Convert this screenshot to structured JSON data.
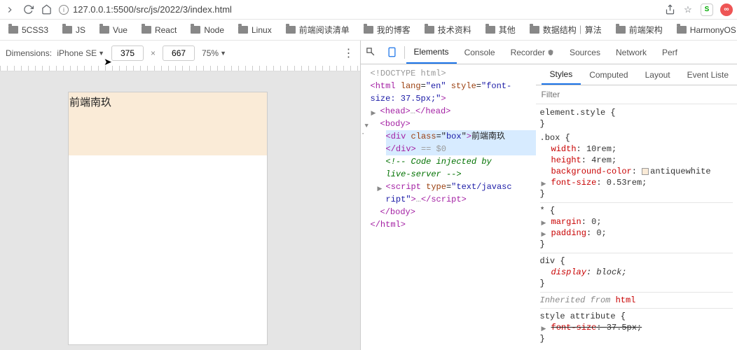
{
  "url": "127.0.0.1:5500/src/js/2022/3/index.html",
  "bookmarks": [
    "5CSS3",
    "JS",
    "Vue",
    "React",
    "Node",
    "Linux",
    "前端阅读清单",
    "我的博客",
    "技术资料",
    "其他",
    "数据结构｜算法",
    "前端架构",
    "HarmonyOS"
  ],
  "device": {
    "label_prefix": "Dimensions:",
    "name": "iPhone SE",
    "width": "375",
    "height": "667",
    "zoom": "75%"
  },
  "box_text": "前端南玖",
  "devtools": {
    "tabs": {
      "elements": "Elements",
      "console": "Console",
      "recorder": "Recorder",
      "sources": "Sources",
      "network": "Network",
      "perf": "Perf"
    },
    "styles_tabs": {
      "styles": "Styles",
      "computed": "Computed",
      "layout": "Layout",
      "eventlisteners": "Event Liste"
    },
    "filter_placeholder": "Filter"
  },
  "dom": {
    "doctype": "<!DOCTYPE html>",
    "html_open1": "<html lang=\"en\" style=\"font-",
    "html_open2": "size: 37.5px;\">",
    "head": {
      "open": "<head>",
      "dots": "…",
      "close": "</head>"
    },
    "body_open": "<body>",
    "div": {
      "open1": "<div class=\"",
      "class": "box",
      "open2": "\">",
      "text": "前端南玖",
      "close": "</div>",
      "eqsel": " == $0"
    },
    "comment": "<!-- Code injected by live-server -->",
    "script": {
      "open1": "<script type=\"",
      "type": "text/javasc",
      "open2": "ript\">",
      "dots": "…",
      "close": "</script>"
    },
    "body_close": "</body>",
    "html_close": "</html>"
  },
  "css": {
    "element_style": {
      "sel": "element.style",
      "open": " {",
      "close": "}"
    },
    "box": {
      "sel": ".box",
      "open": " {",
      "close": "}",
      "rules": [
        {
          "prop": "width",
          "val": "10rem;"
        },
        {
          "prop": "height",
          "val": "4rem;"
        },
        {
          "prop": "background-color",
          "val": "antiquewhite"
        },
        {
          "prop": "font-size",
          "val": "0.53rem;"
        }
      ]
    },
    "star": {
      "sel": "*",
      "open": " {",
      "close": "}",
      "rules": [
        {
          "prop": "margin",
          "val": "0;"
        },
        {
          "prop": "padding",
          "val": "0;"
        }
      ]
    },
    "div": {
      "sel": "div",
      "open": " {",
      "close": "}",
      "rules": [
        {
          "prop": "display",
          "val": "block;",
          "italic": true
        }
      ]
    },
    "inherited": "Inherited from ",
    "inherited_el": "html",
    "style_attr": {
      "sel": "style attribute",
      "open": " {",
      "close": "}",
      "rules": [
        {
          "prop": "font-size",
          "val": "37.5px;",
          "strike": true
        }
      ]
    }
  }
}
